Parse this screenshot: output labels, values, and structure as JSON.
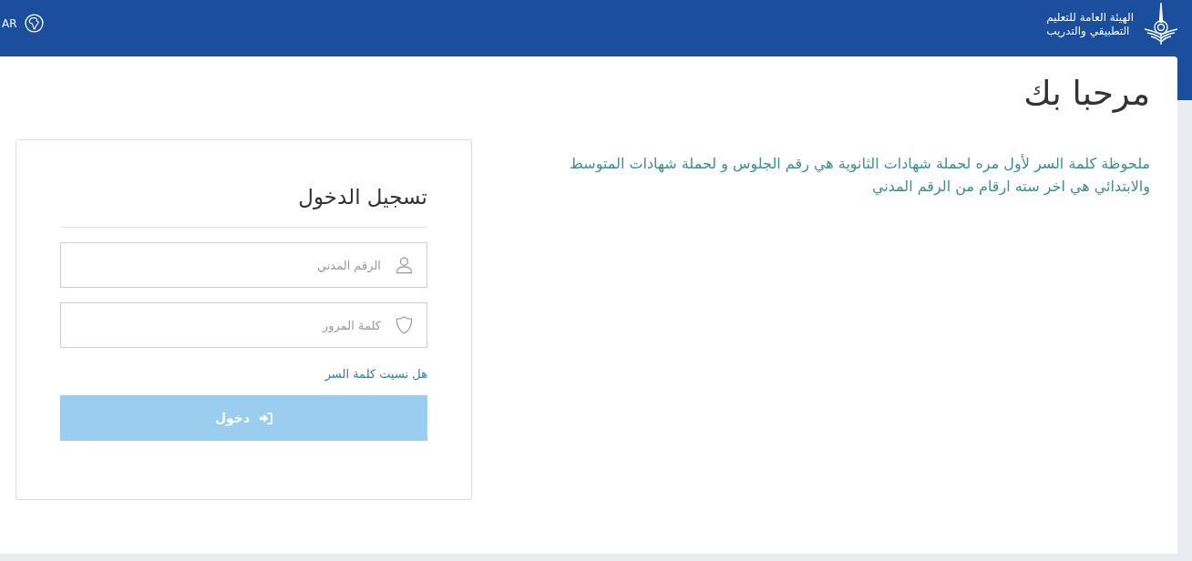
{
  "header": {
    "language": {
      "label": "AR"
    },
    "organization": {
      "name_lines": [
        "الهيئة العامة للتعليم",
        "التطبيقي والتدريب"
      ]
    }
  },
  "welcome": {
    "title": "مرحبا بك",
    "note": "ملحوظة كلمة السر لأول مره لحملة شهادات الثانوية هي رقم الجلوس و لحملة شهادات المتوسط والابتدائي هي اخر سته ارقام من الرقم المدني"
  },
  "login": {
    "title": "تسجيل الدخول",
    "fields": [
      {
        "kind": "user",
        "placeholder": "الرقم المدني"
      },
      {
        "kind": "password",
        "placeholder": "كلمة المرور"
      }
    ],
    "forgot_link": "هل نسيت كلمة السر",
    "submit": {
      "label": "دخول",
      "disabled": true
    }
  }
}
